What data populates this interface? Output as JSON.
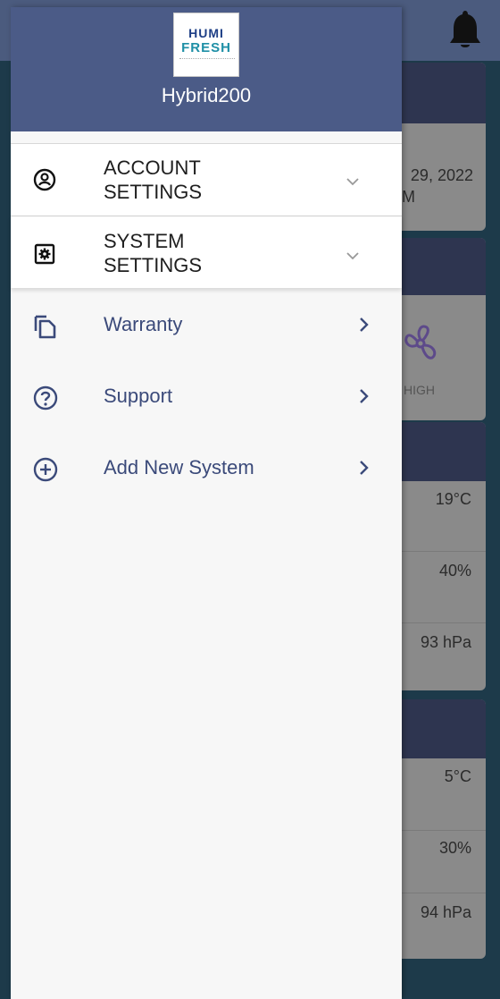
{
  "app": {
    "name": "Hybrid200",
    "logo_line1": "HUMI",
    "logo_line2": "FRESH"
  },
  "sections": [
    {
      "label": "ACCOUNT\nSETTINGS",
      "icon": "account-circle-icon"
    },
    {
      "label": "SYSTEM\nSETTINGS",
      "icon": "settings-gear-icon"
    }
  ],
  "items": [
    {
      "label": "Warranty",
      "icon": "copy-document-icon"
    },
    {
      "label": "Support",
      "icon": "help-circle-icon"
    },
    {
      "label": "Add New System",
      "icon": "add-circle-icon"
    }
  ],
  "background": {
    "date_partial": "29, 2022",
    "time_partial": "M",
    "fan_speed": "HIGH",
    "indoor": {
      "temperature": "19°C",
      "humidity": "40%",
      "pressure": "93 hPa"
    },
    "outdoor": {
      "temperature": "5°C",
      "humidity": "30%",
      "pressure": "94 hPa"
    }
  }
}
